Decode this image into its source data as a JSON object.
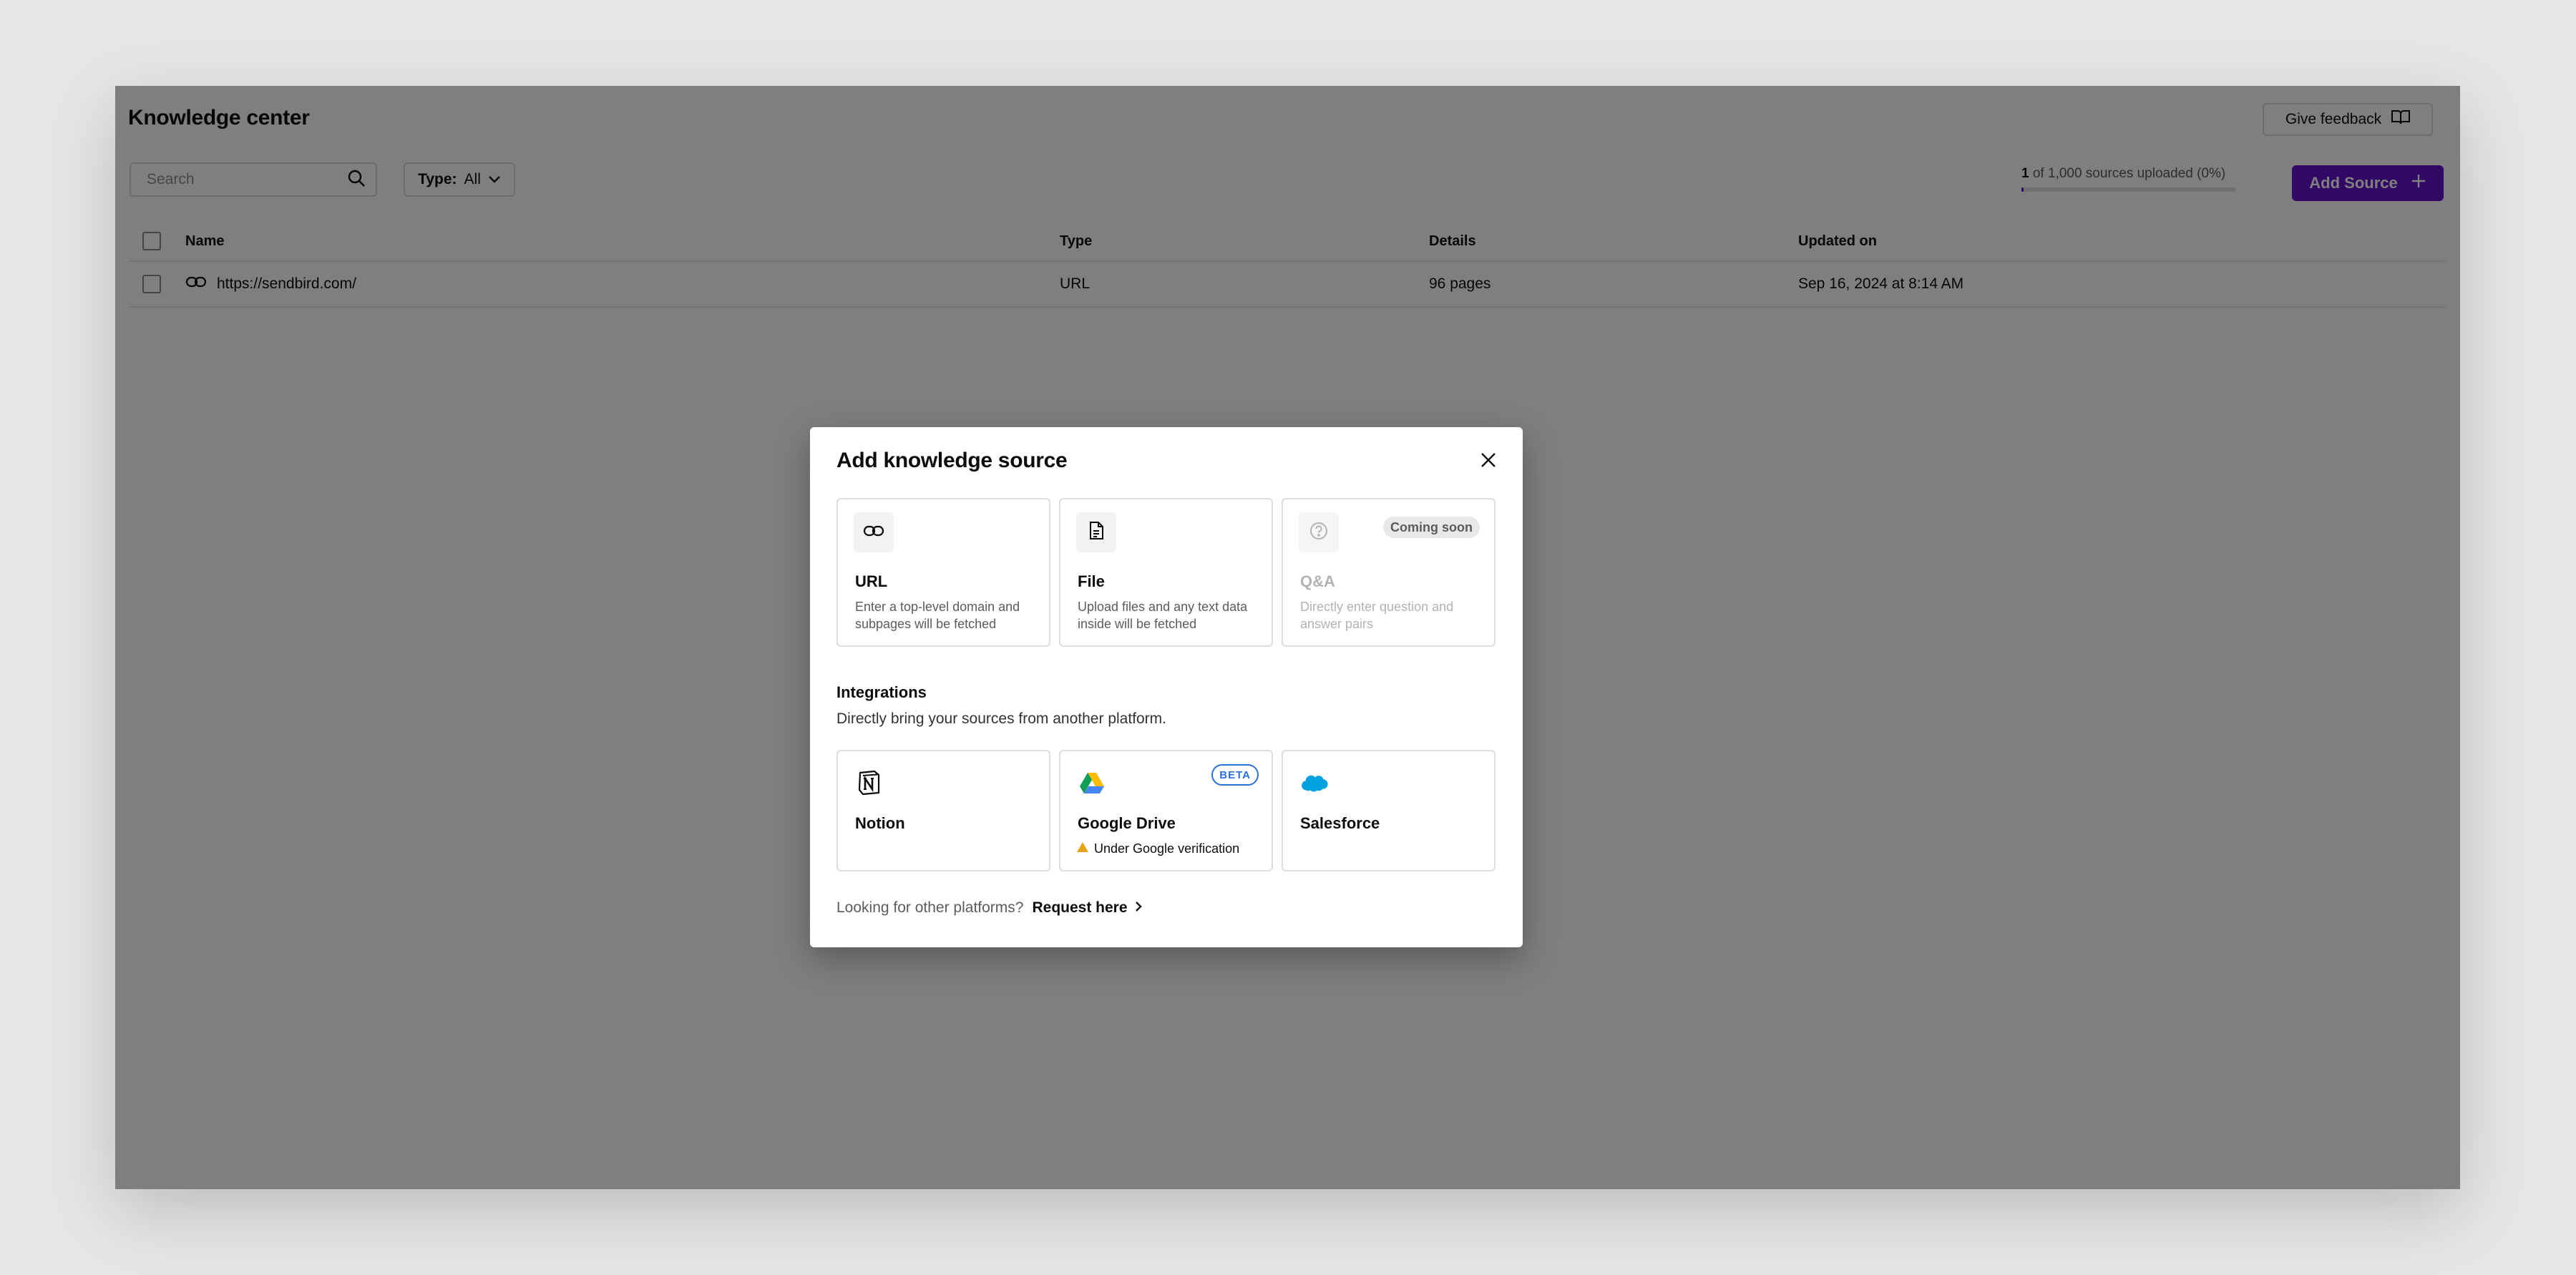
{
  "header": {
    "title": "Knowledge center",
    "feedback_label": "Give feedback"
  },
  "toolbar": {
    "search_placeholder": "Search",
    "type_label": "Type:",
    "type_value": "All",
    "usage_count": "1",
    "usage_text": "of 1,000 sources uploaded (0%)",
    "usage_fraction": 0.001,
    "add_source_label": "Add Source"
  },
  "table": {
    "columns": [
      "Name",
      "Type",
      "Details",
      "Updated on"
    ],
    "rows": [
      {
        "name": "https://sendbird.com/",
        "type": "URL",
        "details": "96 pages",
        "updated": "Sep 16, 2024 at 8:14 AM",
        "icon": "link-icon"
      }
    ]
  },
  "modal": {
    "title": "Add knowledge source",
    "sources": [
      {
        "title": "URL",
        "desc": "Enter a top-level domain and subpages will be fetched",
        "icon": "link-icon"
      },
      {
        "title": "File",
        "desc": "Upload files and any text data inside will be fetched",
        "icon": "file-icon"
      },
      {
        "title": "Q&A",
        "desc": "Directly enter question and answer pairs",
        "icon": "question-icon",
        "badge": "Coming soon"
      }
    ],
    "integrations_title": "Integrations",
    "integrations_desc": "Directly bring your sources from another platform.",
    "integrations": [
      {
        "title": "Notion",
        "icon": "notion-icon"
      },
      {
        "title": "Google Drive",
        "icon": "google-drive-icon",
        "badge": "BETA",
        "status": "Under Google verification"
      },
      {
        "title": "Salesforce",
        "icon": "salesforce-icon"
      }
    ],
    "footer_question": "Looking for other platforms?",
    "footer_link": "Request here"
  },
  "colors": {
    "accent": "#6210cc",
    "beta_blue": "#2c6fde",
    "warning": "#e8a317",
    "overlay": "rgba(0,0,0,0.5)"
  }
}
